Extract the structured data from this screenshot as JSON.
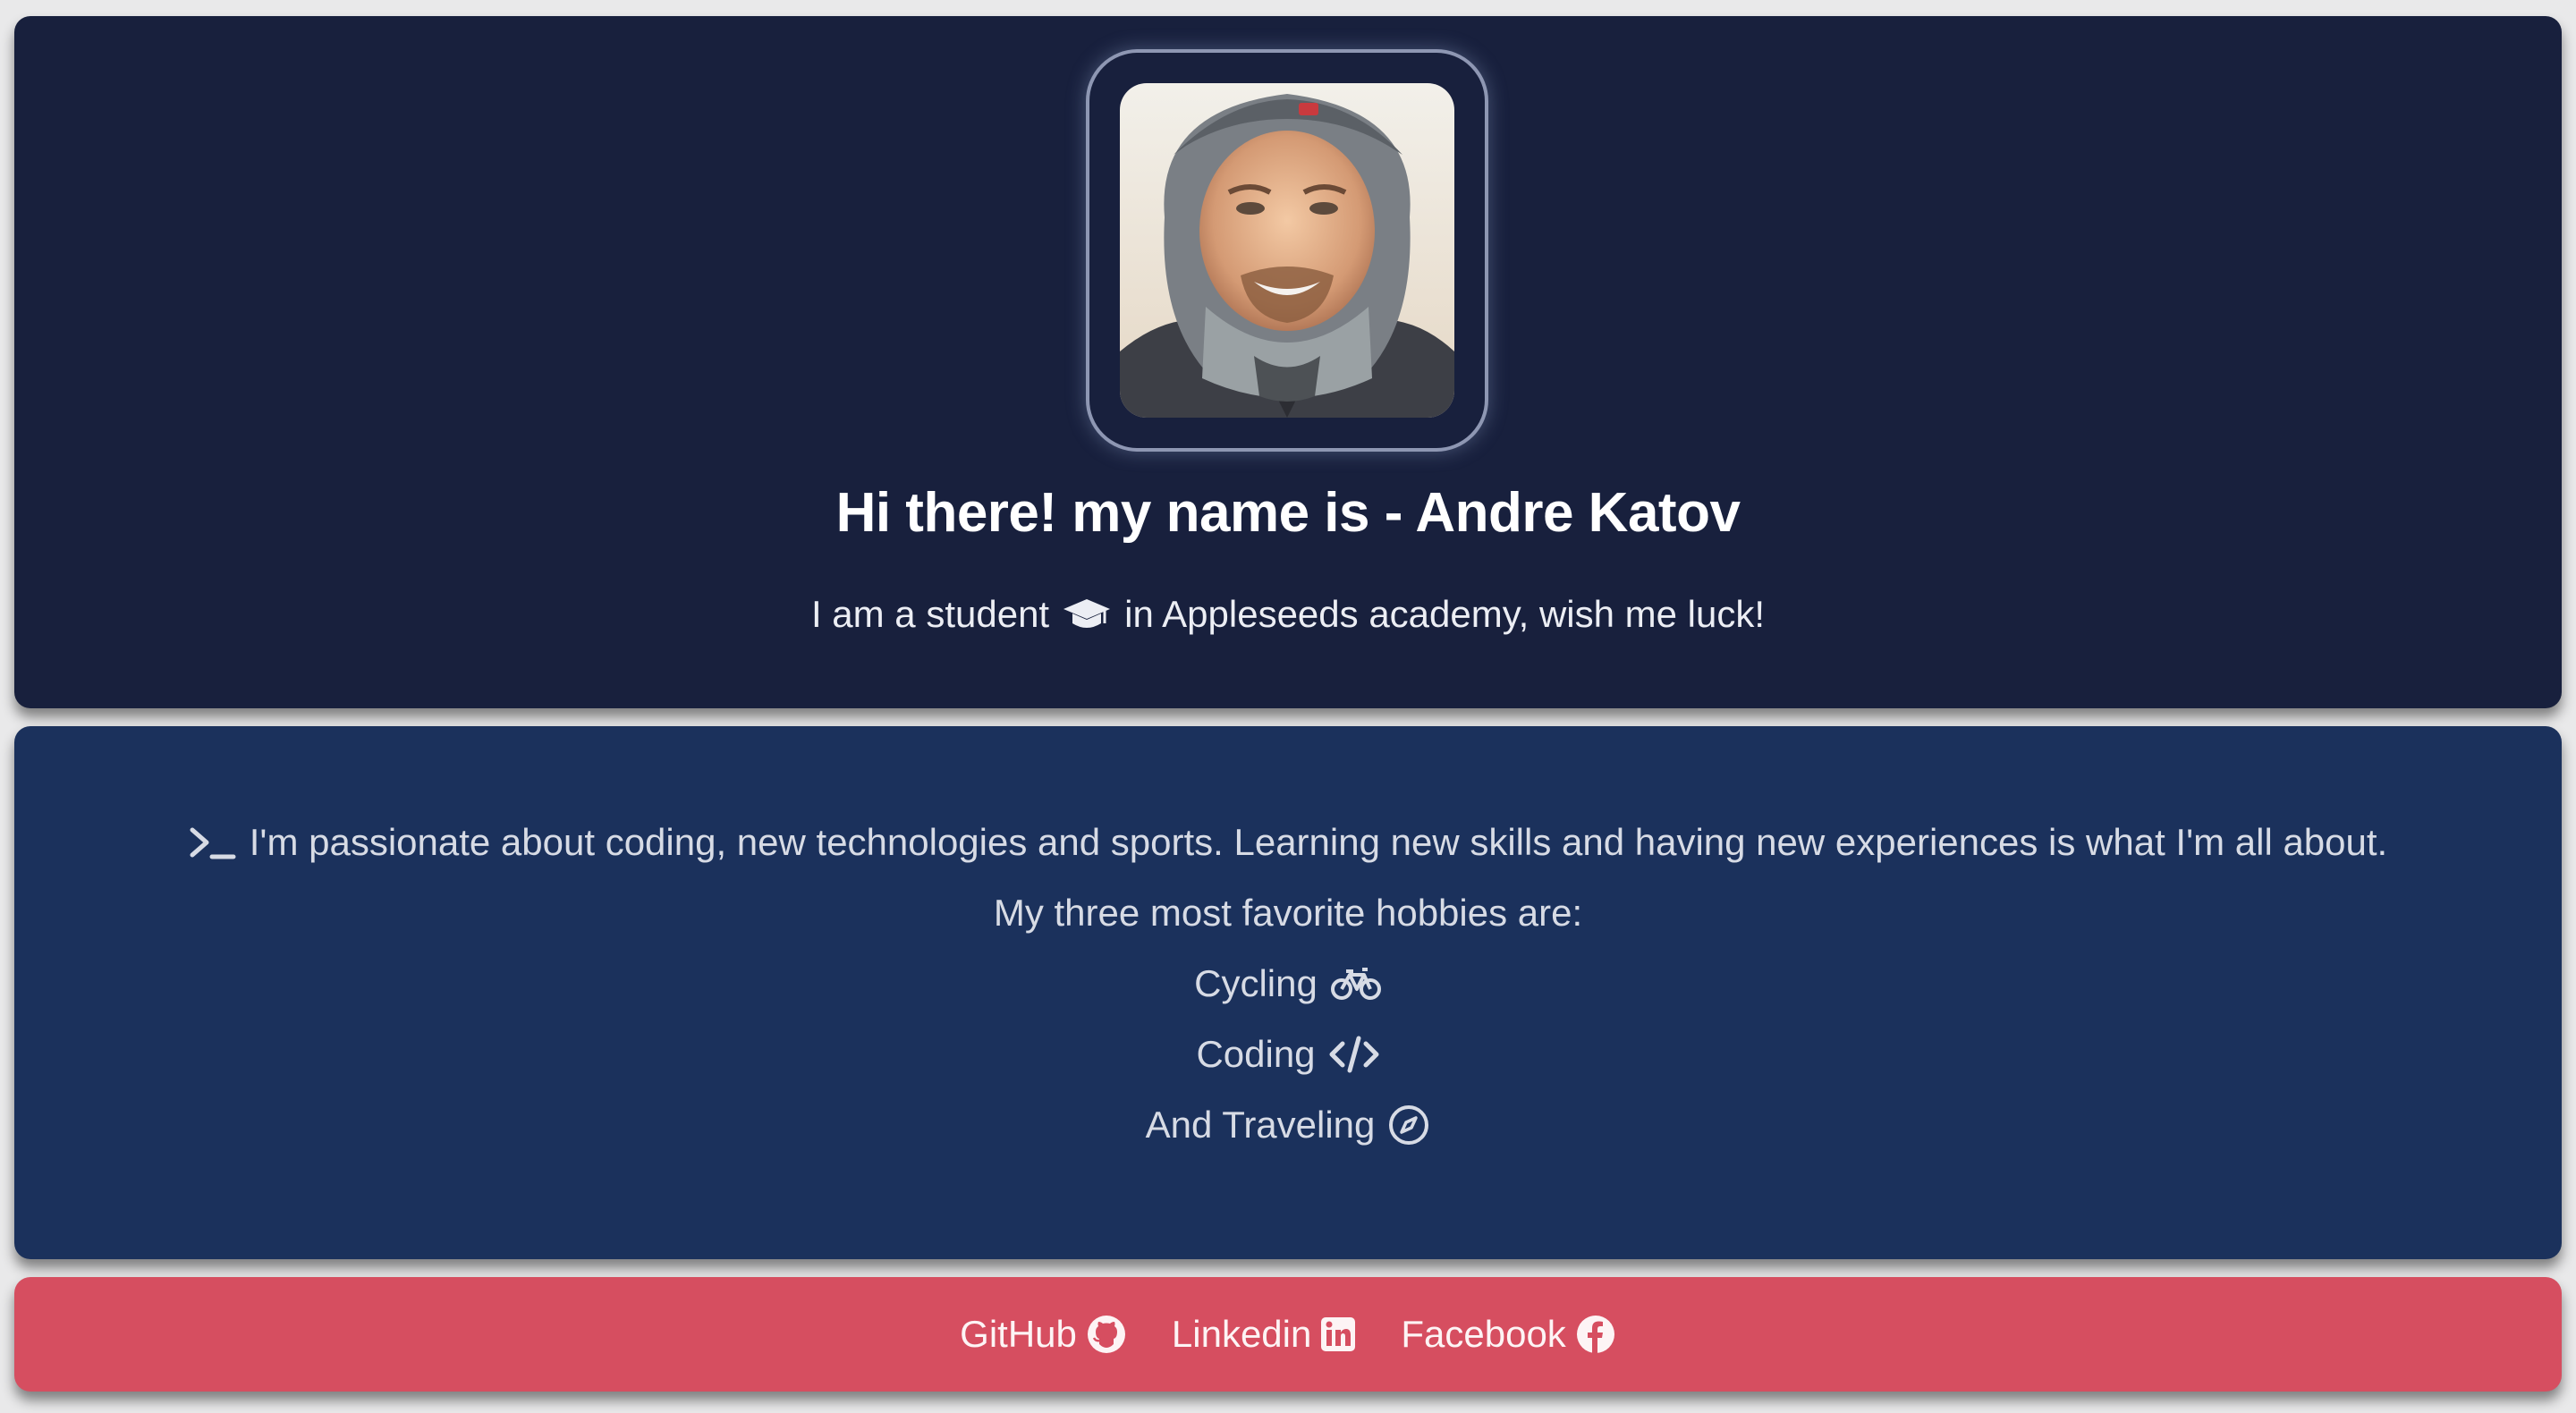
{
  "intro": {
    "avatar_alt": "Andre Katov profile photo",
    "title": "Hi there! my name is - Andre Katov",
    "subtitle_before": "I am a student",
    "subtitle_icon": "graduation-cap-icon",
    "subtitle_after": "in Appleseeds academy, wish me luck!"
  },
  "about": {
    "passion_icon": "terminal-icon",
    "passion": "I'm passionate about coding, new technologies and sports. Learning new skills and having new experiences is what I'm all about.",
    "hobbies_intro": "My three most favorite hobbies are:",
    "hobbies": [
      {
        "label": "Cycling",
        "icon": "bicycle-icon"
      },
      {
        "label": "Coding",
        "icon": "code-icon"
      },
      {
        "label": "And Traveling",
        "icon": "compass-icon"
      }
    ]
  },
  "links": [
    {
      "label": "GitHub",
      "icon": "github-icon"
    },
    {
      "label": "Linkedin",
      "icon": "linkedin-icon"
    },
    {
      "label": "Facebook",
      "icon": "facebook-icon"
    }
  ],
  "colors": {
    "page_bg": "#e9e9ea",
    "intro_bg": "#18203d",
    "about_bg": "#1b315c",
    "links_bg": "#d64e60",
    "text_light": "#ffffff",
    "text_muted": "#d7dbe5"
  }
}
